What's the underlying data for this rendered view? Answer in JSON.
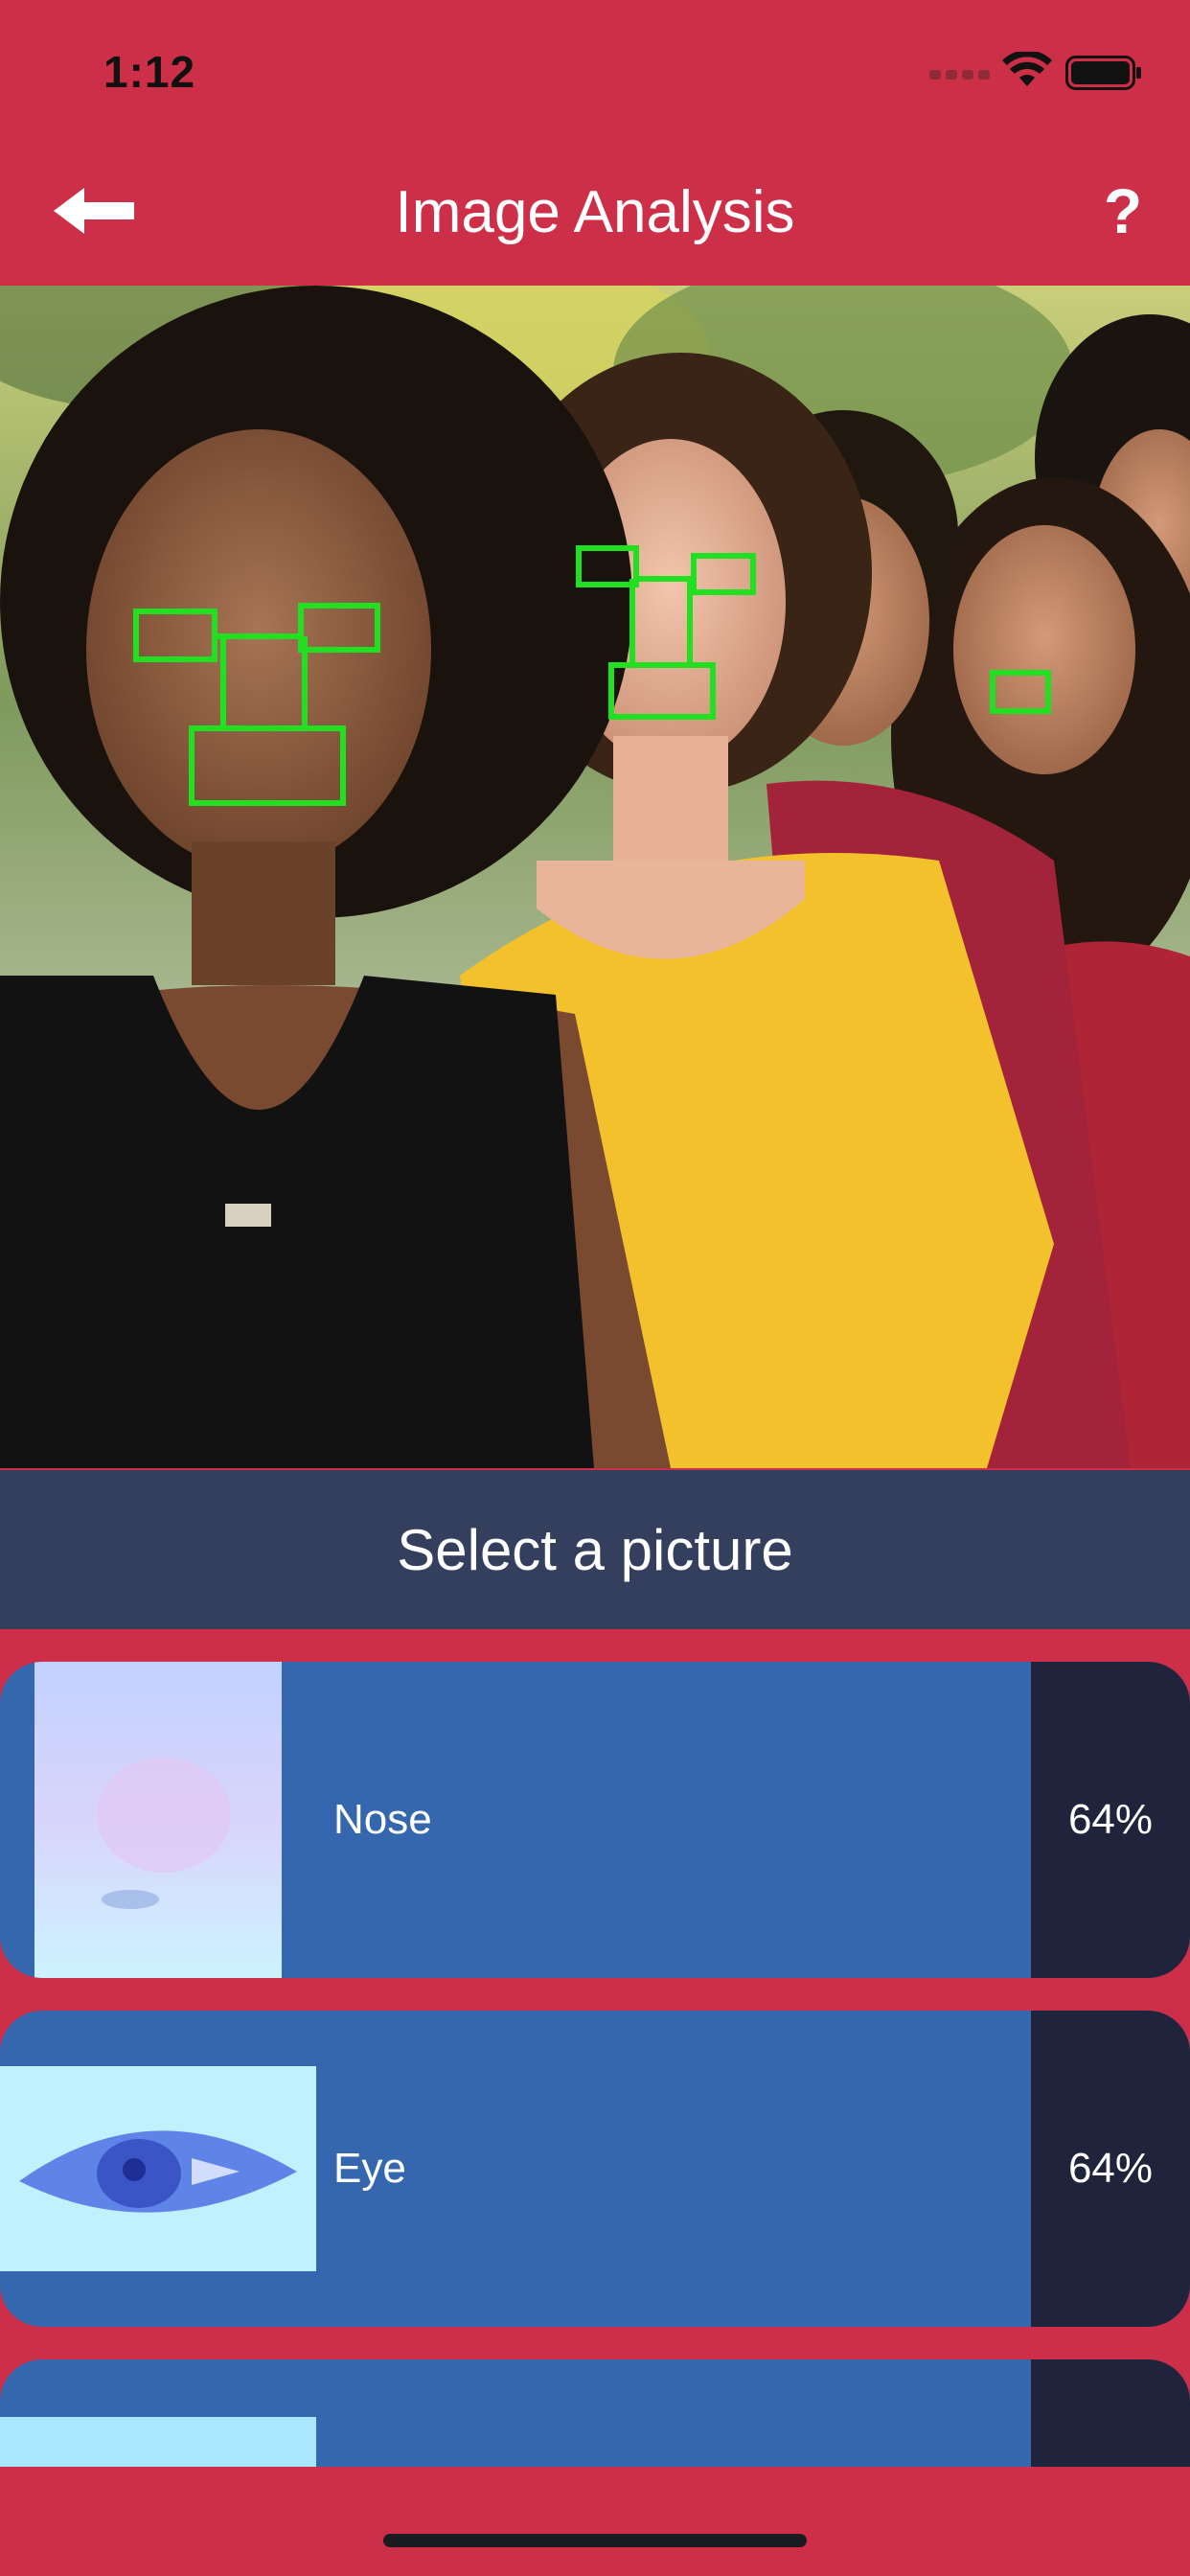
{
  "status_bar": {
    "time": "1:12"
  },
  "nav": {
    "title": "Image Analysis",
    "help_label": "?"
  },
  "select_button": {
    "label": "Select a picture"
  },
  "results": [
    {
      "label": "Nose",
      "confidence": "64%"
    },
    {
      "label": "Eye",
      "confidence": "64%"
    },
    {
      "label": "",
      "confidence": ""
    }
  ],
  "colors": {
    "background": "#cc2f47",
    "select_bar": "#343f5e",
    "row_fill": "#3567ae",
    "confidence_fill": "#1f233b",
    "detection_box": "#21e021"
  },
  "icons": {
    "back": "arrow-left-icon",
    "help": "question-mark-icon",
    "wifi": "wifi-icon",
    "battery": "battery-icon",
    "signal": "signal-icon"
  }
}
